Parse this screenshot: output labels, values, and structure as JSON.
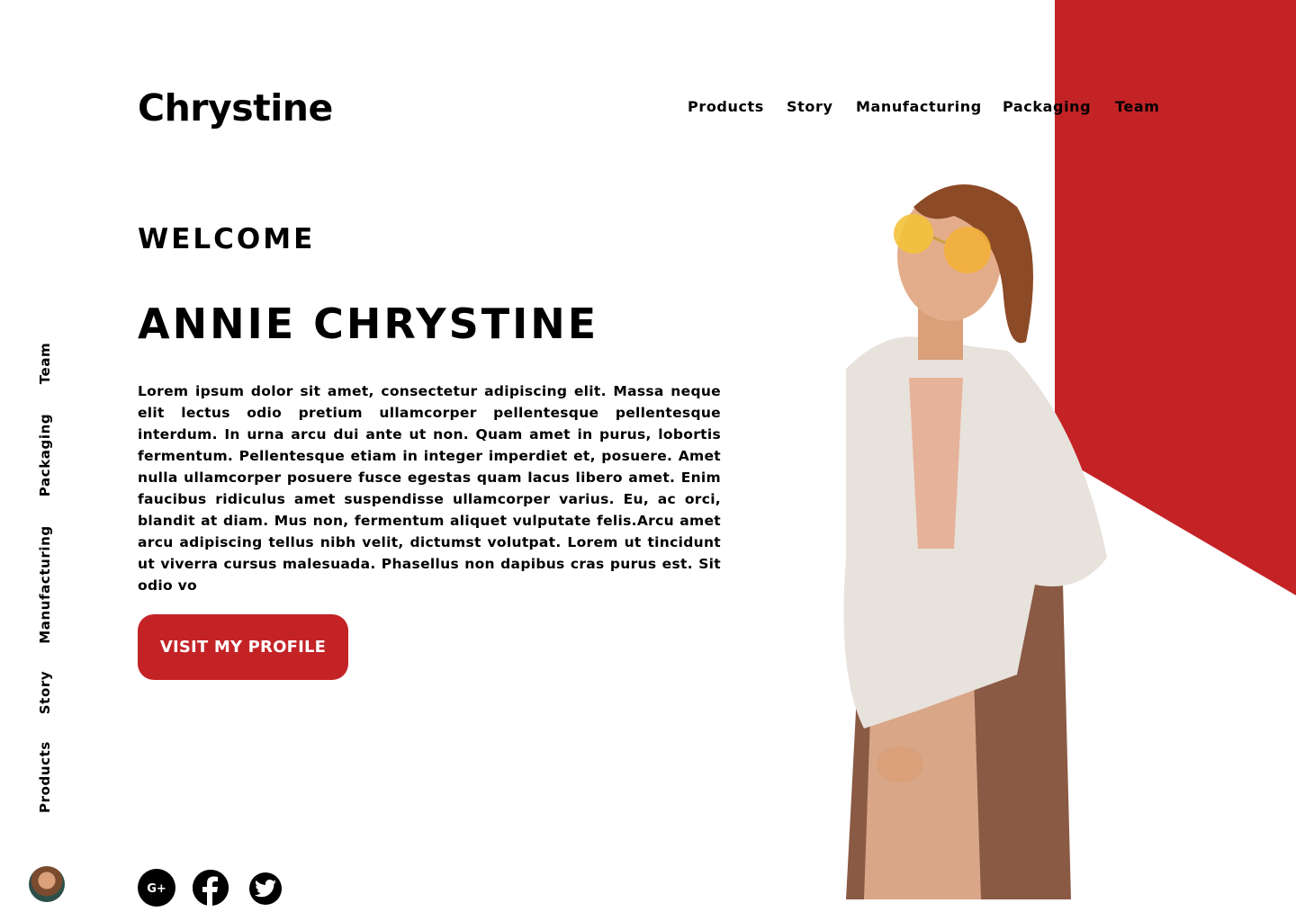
{
  "brand": {
    "logo": "Chrystine"
  },
  "colors": {
    "accent": "#c42326",
    "text": "#000000",
    "background": "#ffffff"
  },
  "top_nav": [
    {
      "label": "Products"
    },
    {
      "label": "Story"
    },
    {
      "label": "Manufacturing"
    },
    {
      "label": "Packaging"
    },
    {
      "label": "Team"
    }
  ],
  "side_nav": [
    {
      "label": "Team"
    },
    {
      "label": "Packaging"
    },
    {
      "label": "Manufacturing"
    },
    {
      "label": "Story"
    },
    {
      "label": "Products"
    }
  ],
  "hero": {
    "eyebrow": "WELCOME",
    "name": "ANNIE CHRYSTINE",
    "bio": "Lorem ipsum dolor sit amet, consectetur adipiscing elit. Massa neque elit lectus odio pretium ullamcorper pellentesque pellentesque interdum. In urna arcu dui ante ut non. Quam amet in purus, lobortis fermentum. Pellentesque etiam in integer imperdiet et, posuere. Amet nulla ullamcorper posuere fusce egestas quam lacus libero amet. Enim faucibus ridiculus amet suspendisse ullamcorper varius. Eu, ac orci, blandit at diam. Mus non, fermentum aliquet vulputate felis.Arcu amet arcu adipiscing tellus nibh velit, dictumst volutpat. Lorem ut tincidunt ut viverra cursus malesuada. Phasellus non dapibus cras purus est. Sit odio vo",
    "cta_label": "VISIT MY PROFILE"
  },
  "social": [
    {
      "icon": "google-plus-icon",
      "glyph": "G+"
    },
    {
      "icon": "facebook-icon"
    },
    {
      "icon": "twitter-icon"
    }
  ],
  "avatar": {
    "icon": "avatar"
  }
}
